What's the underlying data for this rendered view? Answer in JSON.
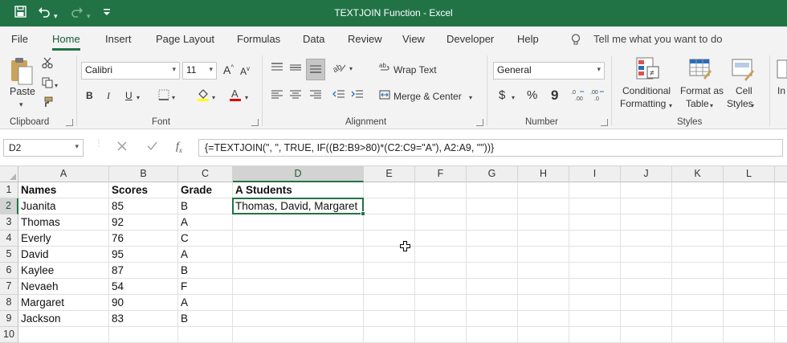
{
  "titlebar": {
    "title": "TEXTJOIN Function  -  Excel",
    "icons": [
      "save-icon",
      "undo-icon",
      "redo-icon",
      "customize-icon"
    ]
  },
  "menu": {
    "tabs": [
      "File",
      "Home",
      "Insert",
      "Page Layout",
      "Formulas",
      "Data",
      "Review",
      "View",
      "Developer",
      "Help"
    ],
    "active_tab": "Home",
    "tell_me": "Tell me what you want to do"
  },
  "ribbon": {
    "clipboard": {
      "paste": "Paste",
      "label": "Clipboard"
    },
    "font": {
      "name": "Calibri",
      "size": "11",
      "label": "Font",
      "bold": "B",
      "italic": "I",
      "underline": "U",
      "grow": "A",
      "shrink": "A"
    },
    "alignment": {
      "wrap_text": "Wrap Text",
      "merge_center": "Merge & Center",
      "label": "Alignment"
    },
    "number": {
      "format": "General",
      "currency": "$",
      "percent": "%",
      "comma": "9",
      "label": "Number"
    },
    "styles": {
      "conditional": "Conditional",
      "formatting": "Formatting",
      "format_as": "Format as",
      "table": "Table",
      "cell": "Cell",
      "cell_styles": "Styles",
      "label": "Styles"
    },
    "cells": {
      "insert": "In"
    }
  },
  "formula_bar": {
    "name_box": "D2",
    "formula": "{=TEXTJOIN(\", \", TRUE, IF((B2:B9>80)*(C2:C9=\"A\"), A2:A9, \"\"))}"
  },
  "sheet": {
    "columns": [
      "A",
      "B",
      "C",
      "D",
      "E",
      "F",
      "G",
      "H",
      "I",
      "J",
      "K",
      "L"
    ],
    "rows": [
      "1",
      "2",
      "3",
      "4",
      "5",
      "6",
      "7",
      "8",
      "9",
      "10"
    ],
    "selected_col": "D",
    "selected_row": "2",
    "cells": [
      [
        "Names",
        "Scores",
        "Grade",
        "A Students"
      ],
      [
        "Juanita",
        "85",
        "B",
        "Thomas, David, Margaret"
      ],
      [
        "Thomas",
        "92",
        "A",
        ""
      ],
      [
        "Everly",
        "76",
        "C",
        ""
      ],
      [
        "David",
        "95",
        "A",
        ""
      ],
      [
        "Kaylee",
        "87",
        "B",
        ""
      ],
      [
        "Nevaeh",
        "54",
        "F",
        ""
      ],
      [
        "Margaret",
        "90",
        "A",
        ""
      ],
      [
        "Jackson",
        "83",
        "B",
        ""
      ],
      [
        "",
        "",
        "",
        ""
      ]
    ]
  },
  "colors": {
    "accent": "#217346",
    "ribbon_bg": "#f3f3f3"
  }
}
